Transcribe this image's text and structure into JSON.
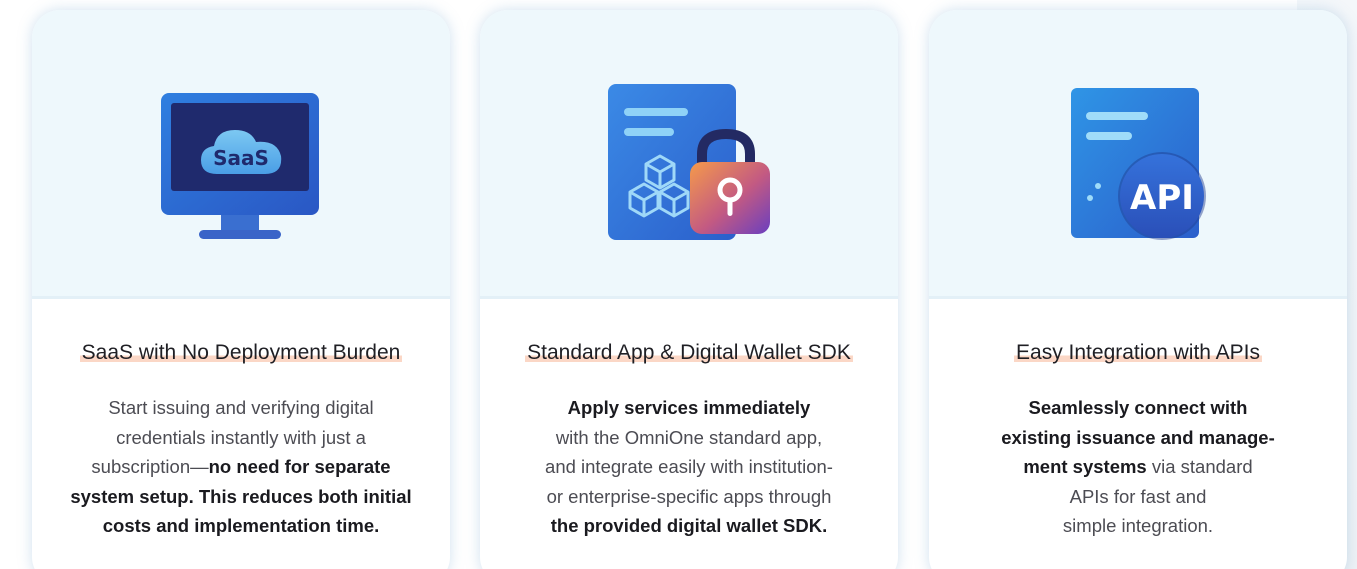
{
  "cards": [
    {
      "icon": "saas-monitor-icon",
      "icon_text": "SaaS",
      "title": "SaaS with No Deployment Burden",
      "desc": [
        {
          "text": "Start issuing and verifying digital",
          "bold": false
        },
        {
          "text": "credentials instantly with just a",
          "bold": false
        },
        {
          "text": "subscription—",
          "bold": false
        },
        {
          "text": "no need for separate",
          "bold": true
        },
        {
          "text": "system setup. This reduces both initial",
          "bold": true
        },
        {
          "text": "costs and implementation time.",
          "bold": true
        }
      ]
    },
    {
      "icon": "wallet-sdk-lock-icon",
      "title": "Standard App & Digital Wallet SDK",
      "desc": [
        {
          "text": "Apply services immediately",
          "bold": true
        },
        {
          "text": "with the OmniOne standard app,",
          "bold": false
        },
        {
          "text": "and integrate easily with institution-",
          "bold": false
        },
        {
          "text": "or enterprise-specific apps through",
          "bold": false
        },
        {
          "text": "the provided digital wallet SDK.",
          "bold": true
        }
      ]
    },
    {
      "icon": "api-document-icon",
      "icon_text": "API",
      "title": "Easy Integration with APIs",
      "desc": [
        {
          "text": "Seamlessly connect with",
          "bold": true
        },
        {
          "text": "existing issuance and manage-",
          "bold": true
        },
        {
          "text": "ment systems",
          "bold": true
        },
        {
          "text": " via standard",
          "bold": false
        },
        {
          "text": "APIs for fast and",
          "bold": false
        },
        {
          "text": "simple integration.",
          "bold": false
        }
      ]
    }
  ],
  "colors": {
    "card_top_bg": "#eef8fc",
    "title_highlight": "#fbd7c6",
    "icon_blue": "#2f6fd6",
    "icon_dark_navy": "#23307a",
    "lock_orange": "#f08a4b",
    "lock_purple": "#7a3fb8"
  }
}
